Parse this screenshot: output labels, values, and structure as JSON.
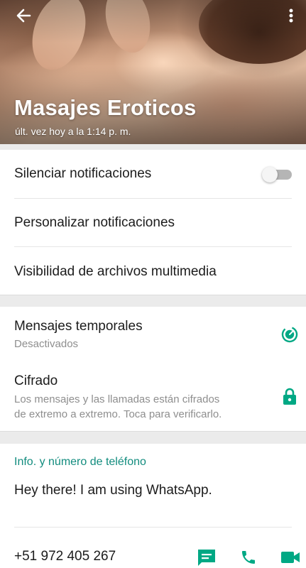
{
  "header": {
    "name": "Masajes Eroticos",
    "last_seen": "últ. vez hoy a la 1:14 p. m."
  },
  "notifications": {
    "mute_label": "Silenciar notificaciones",
    "mute_enabled": false,
    "custom_label": "Personalizar notificaciones",
    "media_visibility_label": "Visibilidad de archivos multimedia"
  },
  "privacy": {
    "disappearing_label": "Mensajes temporales",
    "disappearing_status": "Desactivados",
    "encryption_label": "Cifrado",
    "encryption_line1": "Los mensajes y las llamadas están cifrados",
    "encryption_line2": "de extremo a extremo. Toca para verificarlo."
  },
  "about": {
    "section_title": "Info. y número de teléfono",
    "status": "Hey there! I am using WhatsApp.",
    "phone": "+51 972 405 267"
  },
  "colors": {
    "accent": "#128c7e",
    "accent_bright": "#00a884"
  },
  "icons": {
    "back": "arrow-left-icon",
    "menu": "more-vertical-icon",
    "timer": "timer-icon",
    "lock": "lock-icon",
    "message": "message-icon",
    "call": "phone-icon",
    "video": "video-icon"
  }
}
